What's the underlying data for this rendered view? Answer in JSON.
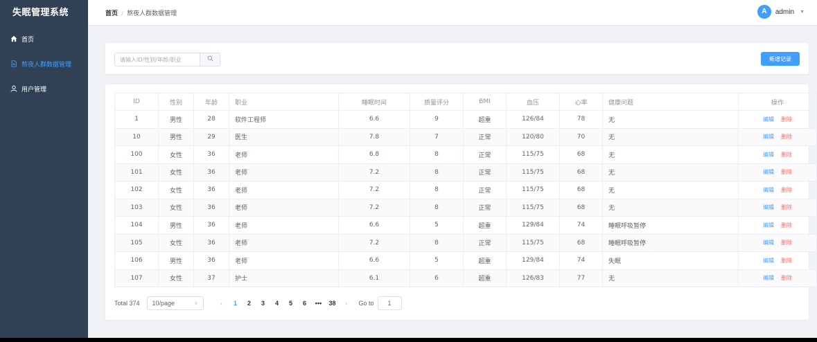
{
  "sidebar": {
    "title": "失眠管理系统",
    "items": [
      {
        "label": "首页",
        "icon": "home-icon"
      },
      {
        "label": "熬夜人群数据管理",
        "icon": "document-icon",
        "active": true
      },
      {
        "label": "用户管理",
        "icon": "user-icon"
      }
    ]
  },
  "header": {
    "breadcrumb_home": "首页",
    "breadcrumb_sep": "/",
    "breadcrumb_current": "熬夜人群数据管理",
    "avatar_letter": "A",
    "username": "admin"
  },
  "search": {
    "placeholder": "请输入ID/性别/年龄/职业",
    "add_label": "新增记录"
  },
  "table": {
    "columns": [
      "ID",
      "性别",
      "年龄",
      "职业",
      "睡眠时间",
      "质量评分",
      "BMI",
      "血压",
      "心率",
      "健康问题",
      "操作"
    ],
    "edit_label": "编辑",
    "delete_label": "删除",
    "rows": [
      [
        "1",
        "男性",
        "28",
        "软件工程师",
        "6.6",
        "9",
        "超重",
        "126/84",
        "78",
        "无"
      ],
      [
        "10",
        "男性",
        "29",
        "医生",
        "7.8",
        "7",
        "正常",
        "120/80",
        "70",
        "无"
      ],
      [
        "100",
        "女性",
        "36",
        "老师",
        "6.8",
        "8",
        "正常",
        "115/75",
        "68",
        "无"
      ],
      [
        "101",
        "女性",
        "36",
        "老师",
        "7.2",
        "8",
        "正常",
        "115/75",
        "68",
        "无"
      ],
      [
        "102",
        "女性",
        "36",
        "老师",
        "7.2",
        "8",
        "正常",
        "115/75",
        "68",
        "无"
      ],
      [
        "103",
        "女性",
        "36",
        "老师",
        "7.2",
        "8",
        "正常",
        "115/75",
        "68",
        "无"
      ],
      [
        "104",
        "男性",
        "36",
        "老师",
        "6.6",
        "5",
        "超重",
        "129/84",
        "74",
        "睡眠呼吸暂停"
      ],
      [
        "105",
        "女性",
        "36",
        "老师",
        "7.2",
        "8",
        "正常",
        "115/75",
        "68",
        "睡眠呼吸暂停"
      ],
      [
        "106",
        "男性",
        "36",
        "老师",
        "6.6",
        "5",
        "超重",
        "129/84",
        "74",
        "失眠"
      ],
      [
        "107",
        "女性",
        "37",
        "护士",
        "6.1",
        "6",
        "超重",
        "126/83",
        "77",
        "无"
      ]
    ]
  },
  "pagination": {
    "total": "Total 374",
    "page_size": "10/page",
    "prev": "‹",
    "next": "›",
    "pages": [
      "1",
      "2",
      "3",
      "4",
      "5",
      "6",
      "•••",
      "38"
    ],
    "current": "1",
    "goto_label": "Go to",
    "goto_value": "1"
  },
  "colors": {
    "sidebar_bg": "#304156",
    "accent": "#409eff",
    "danger": "#f56c6c"
  }
}
